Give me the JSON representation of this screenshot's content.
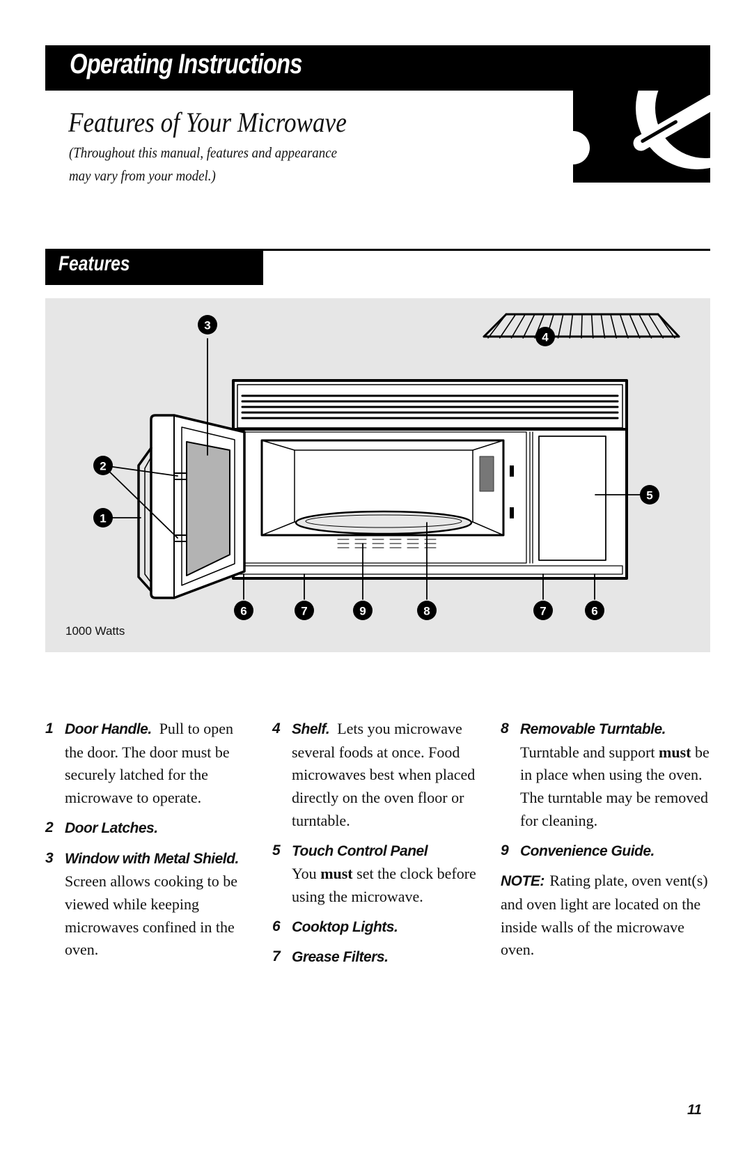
{
  "header": {
    "section": "Operating Instructions",
    "title": "Features of Your Microwave",
    "subtitle_line1": "(Throughout this manual, features and appearance",
    "subtitle_line2": "may vary from your model.)"
  },
  "features_section": {
    "title": "Features",
    "wattage_label": "1000 Watts",
    "callouts": [
      "1",
      "2",
      "3",
      "4",
      "5",
      "6",
      "7",
      "8",
      "9"
    ]
  },
  "items": [
    {
      "num": "1",
      "label": "Door Handle.",
      "text": "Pull to open the door. The door must be securely latched for the microwave to operate."
    },
    {
      "num": "2",
      "label": "Door Latches.",
      "text": ""
    },
    {
      "num": "3",
      "label": "Window with Metal Shield.",
      "text": "Screen allows cooking to be viewed while keeping microwaves confined in the oven."
    },
    {
      "num": "4",
      "label": "Shelf.",
      "text": "Lets you microwave several foods at once. Food microwaves best when placed directly on the oven floor or turntable."
    },
    {
      "num": "5",
      "label": "Touch Control Panel",
      "text_pre": "You",
      "text_bold": "must",
      "text_post": "set the clock before using the microwave."
    },
    {
      "num": "6",
      "label": "Cooktop Lights.",
      "text": ""
    },
    {
      "num": "7",
      "label": "Grease Filters.",
      "text": ""
    },
    {
      "num": "8",
      "label": "Removable Turntable.",
      "text_pre": "Turntable and support",
      "text_bold": "must",
      "text_post": "be in place when using the oven. The turntable may be removed for cleaning."
    },
    {
      "num": "9",
      "label": "Convenience Guide.",
      "text": ""
    }
  ],
  "note": {
    "label": "NOTE:",
    "text": "Rating plate, oven vent(s) and oven light are located on the inside walls of the microwave oven."
  },
  "page_number": "11"
}
